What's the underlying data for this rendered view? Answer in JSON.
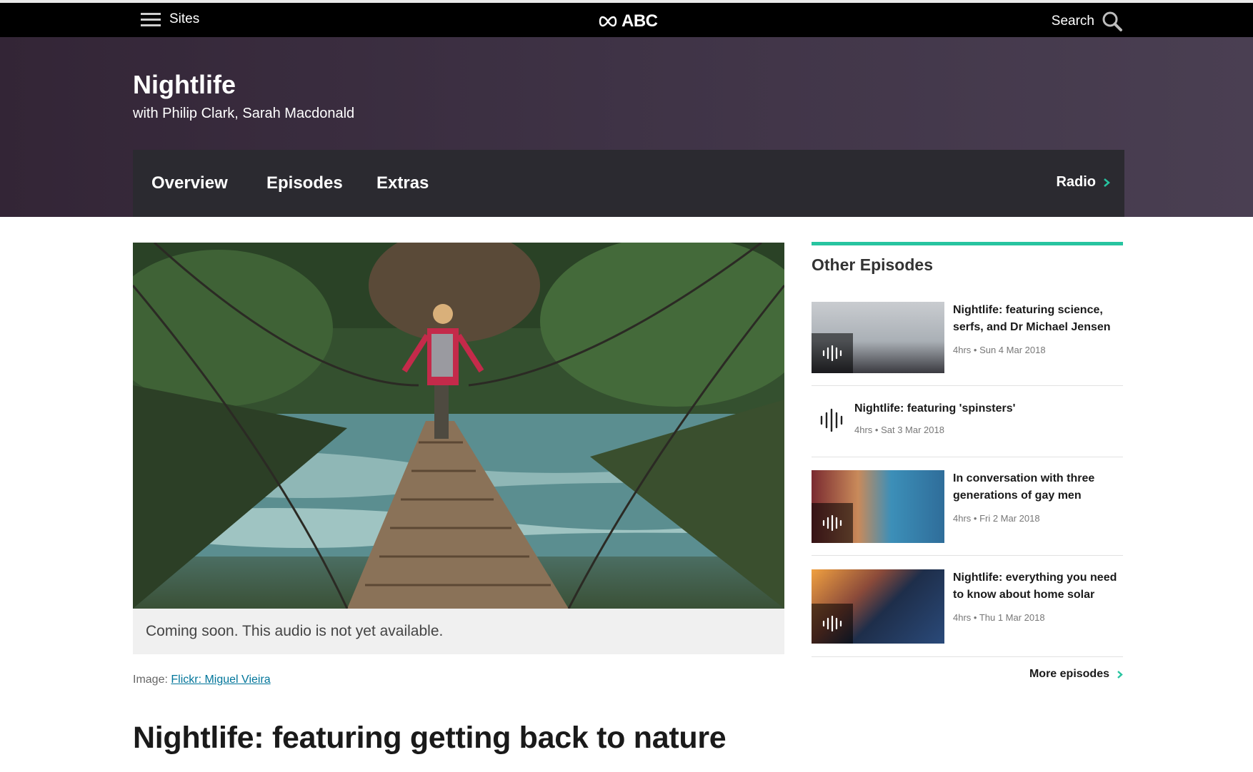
{
  "topbar": {
    "sites_label": "Sites",
    "logo_text": "ABC",
    "search_label": "Search"
  },
  "program": {
    "title": "Nightlife",
    "hosts": "with Philip Clark, Sarah Macdonald",
    "nav": [
      {
        "label": "Overview"
      },
      {
        "label": "Episodes"
      },
      {
        "label": "Extras"
      }
    ],
    "radio_label": "Radio"
  },
  "hero": {
    "caption": "Coming soon. This audio is not yet available.",
    "credit_prefix": "Image:",
    "credit_link": "Flickr: Miguel Vieira"
  },
  "episode": {
    "title": "Nightlife: featuring getting back to nature"
  },
  "sidebar": {
    "heading": "Other Episodes",
    "items": [
      {
        "title": "Nightlife: featuring science, serfs, and Dr Michael Jensen",
        "meta": "4hrs • Sun 4 Mar 2018"
      },
      {
        "title": "Nightlife: featuring 'spinsters'",
        "meta": "4hrs • Sat 3 Mar 2018"
      },
      {
        "title": "In conversation with three generations of gay men",
        "meta": "4hrs • Fri 2 Mar 2018"
      },
      {
        "title": "Nightlife: everything you need to know about home solar",
        "meta": "4hrs • Thu 1 Mar 2018"
      }
    ],
    "more_label": "More episodes"
  },
  "colors": {
    "accent": "#27c4a0",
    "header_bg": "#3f3346",
    "nav_bg": "#2b2a30"
  }
}
